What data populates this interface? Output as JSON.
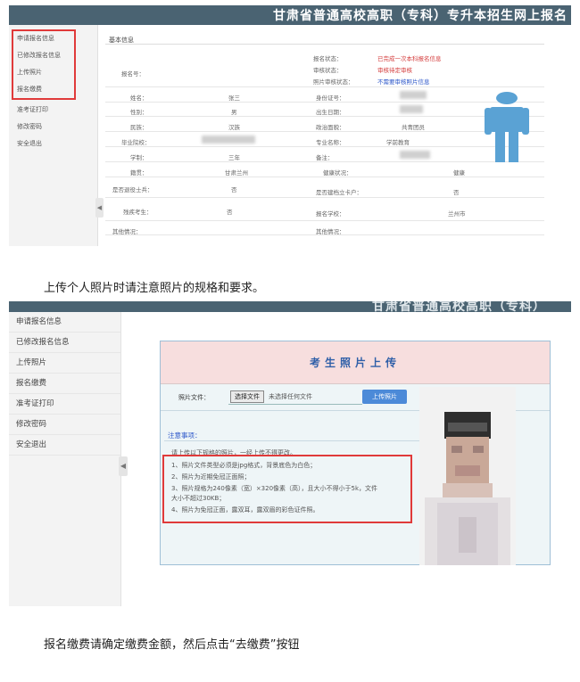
{
  "screenshot1": {
    "banner_title": "甘肃省普通高校高职（专科）专升本招生网上报名",
    "sidebar": {
      "items": [
        "申请报名信息",
        "已修改报名信息",
        "上传照片",
        "报名缴费",
        "准考证打印",
        "修改密码",
        "安全退出"
      ]
    },
    "section_title": "基本信息",
    "fields": {
      "reg_status_label": "报名状态：",
      "reg_status_value": "已完成一次本科报名信息",
      "review_label": "审核状态：",
      "review_value": "审核待定审核",
      "photo_label": "照片审核状态：",
      "photo_value": "不需要审核照片信息",
      "reg_no_label": "报名号：",
      "name_label": "姓名：",
      "name_value": "张三",
      "id_label": "身份证号：",
      "gender_label": "性别：",
      "gender_value": "男",
      "birth_label": "出生日期：",
      "nation_label": "民族：",
      "nation_value": "汉族",
      "political_label": "政治面貌：",
      "political_value": "共青团员",
      "school_label": "毕业院校：",
      "major_label": "专业名称：",
      "major_value": "学前教育",
      "edu_label": "学制：",
      "edu_value": "三年",
      "origin_label": "籍贯：",
      "origin_value": "甘肃兰州",
      "health_label": "健康状况：",
      "health_value": "健康",
      "veteran_label": "是否退役士兵：",
      "veteran_value": "否",
      "poor_label": "是否建档立卡户：",
      "poor_value": "否",
      "disabled_label": "残疾考生：",
      "disabled_value": "否",
      "apply_label": "报名学校：",
      "apply_value": "兰州市",
      "remarks_label": "备注：",
      "other_label": "其他情况："
    }
  },
  "caption1": "上传个人照片时请注意照片的规格和要求。",
  "screenshot2": {
    "banner_title": "甘肃省普通高校高职（专科）",
    "sidebar": {
      "items": [
        "申请报名信息",
        "已修改报名信息",
        "上传照片",
        "报名缴费",
        "准考证打印",
        "修改密码",
        "安全退出"
      ]
    },
    "panel_title": "考生照片上传",
    "file_label": "照片文件：",
    "choose_button": "选择文件",
    "file_status": "未选择任何文件",
    "upload_button": "上传照片",
    "notice_label": "注意事项：",
    "notice_intro": "请上传以下规格的照片，一经上传不得更改。",
    "rules": [
      "1、照片文件类型必须是jpg格式，背景底色为白色；",
      "2、照片为近期免冠正面照；",
      "3、照片规格为240像素（宽）×320像素（高），且大小不得小于5k，文件",
      "大小不超过30KB；",
      "4、照片为免冠正面，露双耳，露双眉的彩色证件照。"
    ]
  },
  "caption2": "报名缴费请确定缴费金额，然后点击“去缴费”按钮",
  "colors": {
    "banner": "#4a6372",
    "highlight_box": "#e03a3a",
    "panel_header": "#f7dede",
    "title_blue": "#2f5fa8",
    "upload_button": "#4c8ad8",
    "avatar_blue": "#5aa2d4"
  }
}
